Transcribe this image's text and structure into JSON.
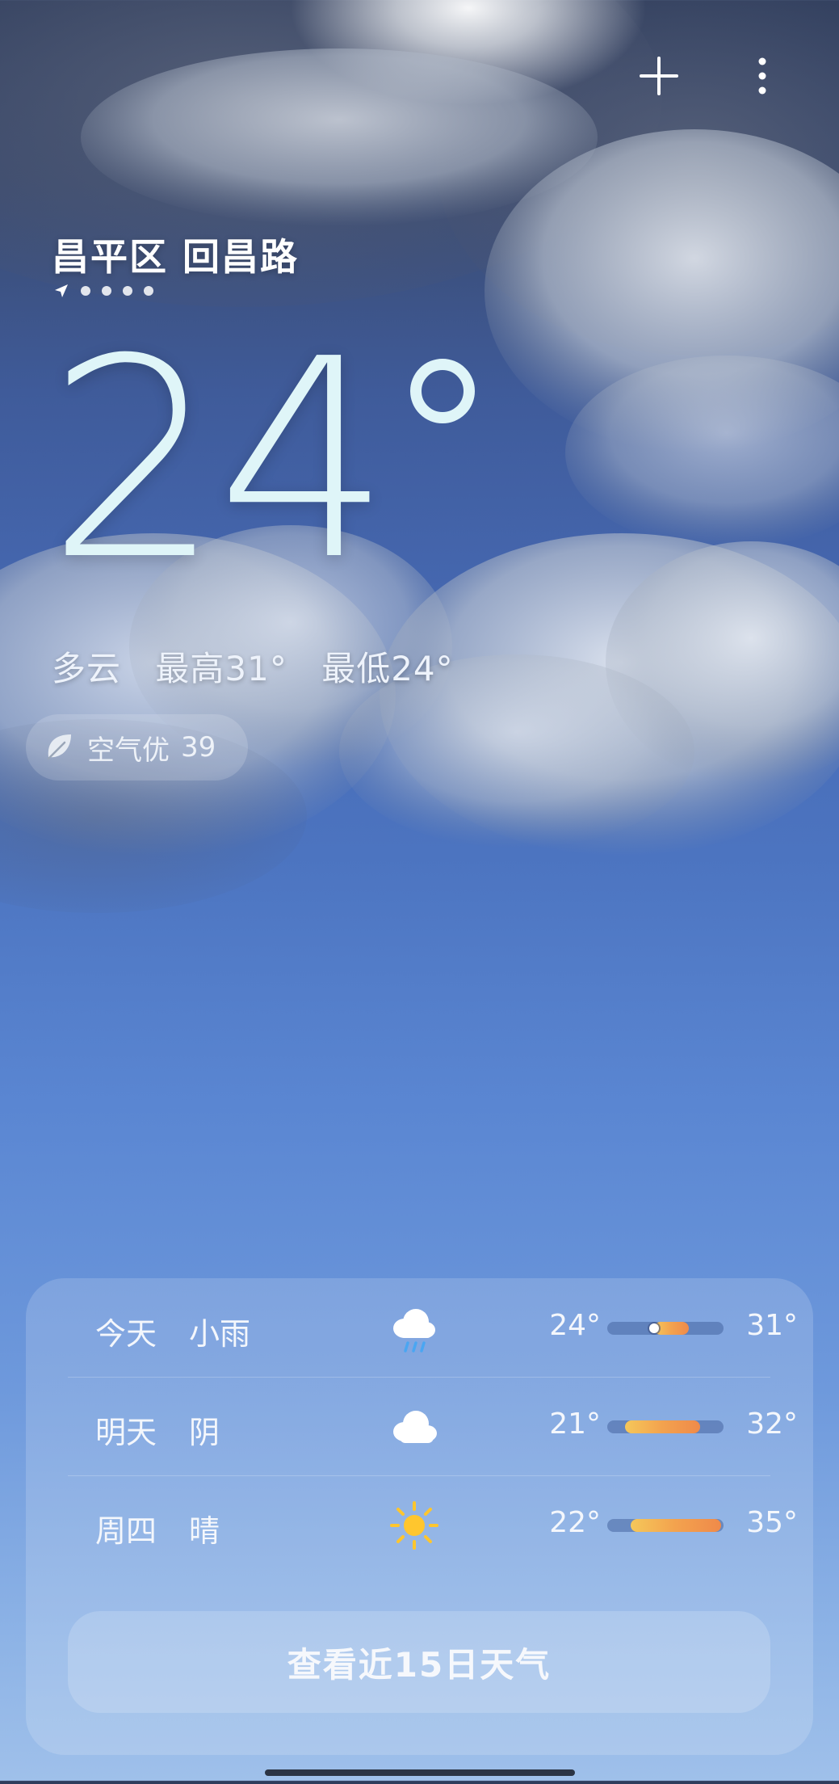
{
  "location": {
    "title": "昌平区 回昌路",
    "page_count": 5,
    "active_index": 0
  },
  "current": {
    "temperature": "24",
    "condition": "多云",
    "high": "最高31°",
    "low": "最低24°"
  },
  "air_quality": {
    "label": "空气优",
    "value": "39"
  },
  "forecast": [
    {
      "day": "今天",
      "condition": "小雨",
      "icon": "light-rain-icon",
      "low": "24°",
      "high": "31°",
      "range_fraction": [
        0.4,
        0.7
      ],
      "current_fraction": 0.4
    },
    {
      "day": "明天",
      "condition": "阴",
      "icon": "cloudy-icon",
      "low": "21°",
      "high": "32°",
      "range_fraction": [
        0.15,
        0.8
      ]
    },
    {
      "day": "周四",
      "condition": "晴",
      "icon": "sunny-icon",
      "low": "22°",
      "high": "35°",
      "range_fraction": [
        0.2,
        0.98
      ]
    }
  ],
  "cta_label": "查看近15日天气",
  "colors": {
    "accent_bar_start": "#f5c75a",
    "accent_bar_end": "#ef8a4a",
    "temp_text": "#dff5f8"
  }
}
